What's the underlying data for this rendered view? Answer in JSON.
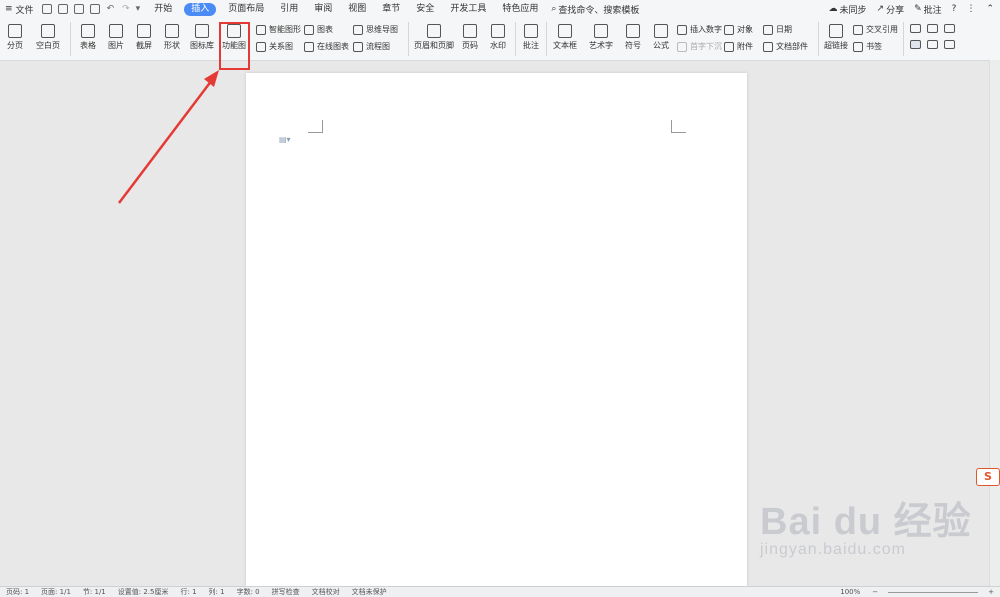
{
  "menu": {
    "file_label": "文件",
    "tabs": [
      "开始",
      "插入",
      "页面布局",
      "引用",
      "审阅",
      "视图",
      "章节",
      "安全",
      "开发工具",
      "特色应用"
    ],
    "active_tab": "插入",
    "search_placeholder": "查找命令、搜索模板",
    "sync_label": "未同步",
    "share_label": "分享",
    "comment_label": "批注"
  },
  "ribbon": {
    "page_break": "分页",
    "blank_page": "空白页",
    "table": "表格",
    "picture": "图片",
    "screenshot": "截屏",
    "shape": "形状",
    "icon_lib": "图标库",
    "function_chart": "功能图",
    "smart_shape": "智能图形",
    "relation_chart": "关系图",
    "chart": "图表",
    "online_chart": "在线图表",
    "mind_map": "思维导图",
    "flowchart": "流程图",
    "header_footer": "页眉和页脚",
    "page_number": "页码",
    "watermark": "水印",
    "comment": "批注",
    "textbox": "文本框",
    "wordart": "艺术字",
    "symbol": "符号",
    "formula": "公式",
    "insert_number": "插入数字",
    "object": "对象",
    "date": "日期",
    "drop_cap": "首字下沉",
    "attachment": "附件",
    "doc_parts": "文档部件",
    "hyperlink": "超链接",
    "cross_ref": "交叉引用",
    "bookmark": "书签"
  },
  "status": {
    "page_num": "页码: 1",
    "pages": "页面: 1/1",
    "section": "节: 1/1",
    "setting": "设置值: 2.5厘米",
    "row": "行: 1",
    "col": "列: 1",
    "words": "字数: 0",
    "spell": "拼写检查",
    "proof": "文档校对",
    "protect": "文档未保护",
    "zoom": "100%"
  },
  "watermark": {
    "main": "Bai du 经验",
    "sub": "jingyan.baidu.com"
  },
  "colors": {
    "accent": "#4a8bf5",
    "highlight": "#e53935"
  }
}
